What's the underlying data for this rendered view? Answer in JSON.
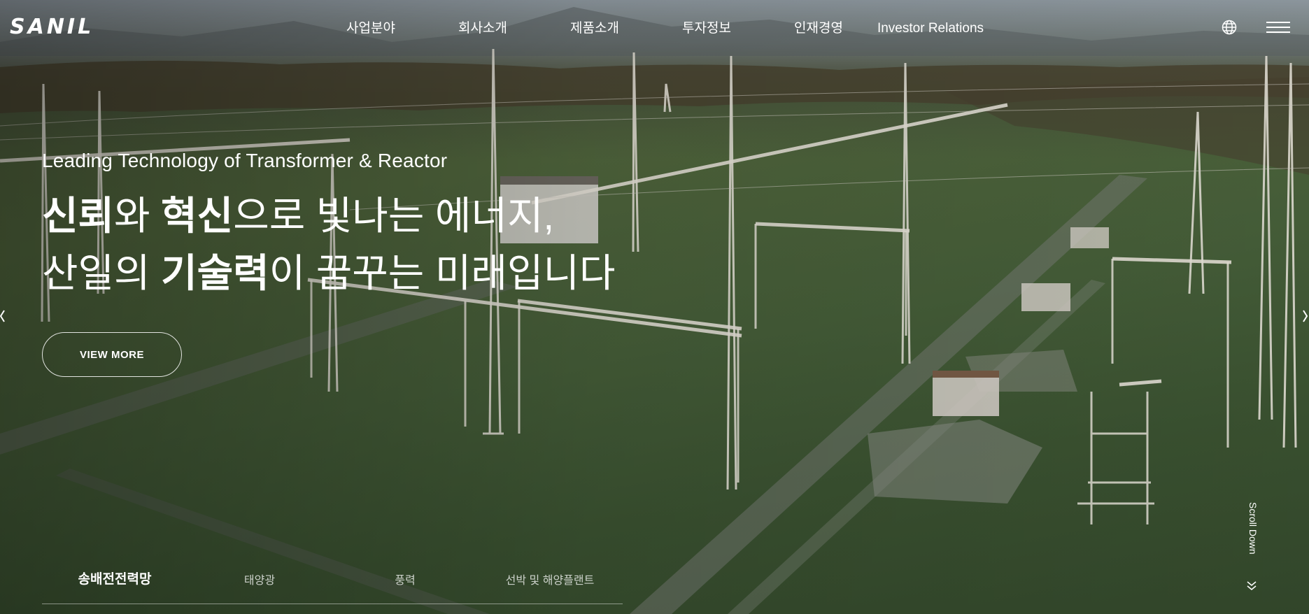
{
  "header": {
    "logo_text": "SANIL",
    "nav": [
      {
        "label": "사업분야"
      },
      {
        "label": "회사소개"
      },
      {
        "label": "제품소개"
      },
      {
        "label": "투자정보"
      },
      {
        "label": "인재경영"
      },
      {
        "label": "Investor Relations"
      }
    ]
  },
  "hero": {
    "subtitle": "Leading Technology of Transformer & Reactor",
    "line1": {
      "b1": "신뢰",
      "t1": "와 ",
      "b2": "혁신",
      "t2": "으로 빛나는 에너지,"
    },
    "line2": {
      "t1": "산일의 ",
      "b1": "기술력",
      "t2": "이 꿈꾸는 미래입니다"
    },
    "button_label": "VIEW MORE"
  },
  "scroll_label": "Scroll Down",
  "tabs": [
    {
      "label": "송배전전력망",
      "active": true
    },
    {
      "label": "태양광",
      "active": false
    },
    {
      "label": "풍력",
      "active": false
    },
    {
      "label": "선박 및 해양플랜트",
      "active": false
    }
  ]
}
